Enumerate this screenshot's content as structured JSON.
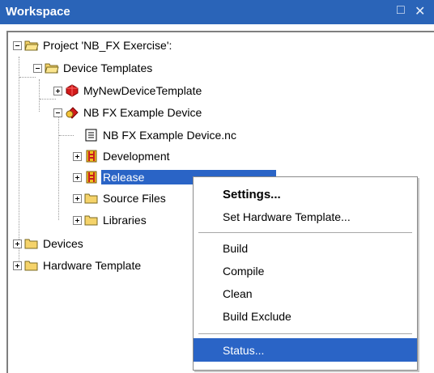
{
  "window": {
    "title": "Workspace",
    "close_glyph": "✕",
    "restore_glyph": "□"
  },
  "tree": {
    "project": "Project 'NB_FX Exercise':",
    "device_templates": "Device Templates",
    "my_new_device_template": "MyNewDeviceTemplate",
    "nb_fx_example_device": "NB FX Example Device",
    "nc_file": "NB FX Example Device.nc",
    "development": "Development",
    "release": "Release",
    "source_files": "Source Files",
    "libraries": "Libraries",
    "devices": "Devices",
    "hardware_templates": "Hardware Template"
  },
  "context_menu": {
    "settings": "Settings...",
    "set_hardware_template": "Set Hardware Template...",
    "build": "Build",
    "compile": "Compile",
    "clean": "Clean",
    "build_exclude": "Build Exclude",
    "status": "Status..."
  },
  "colors": {
    "title_bar": "#2a64b8",
    "selection": "#2a64c6",
    "folder": "#f5d36a"
  },
  "icons": {
    "folder": "folder-icon",
    "open_folder": "folder-open-icon",
    "device_template": "red-gem-icon",
    "device": "red-device-icon",
    "file": "file-icon",
    "config": "ladder-config-icon"
  }
}
